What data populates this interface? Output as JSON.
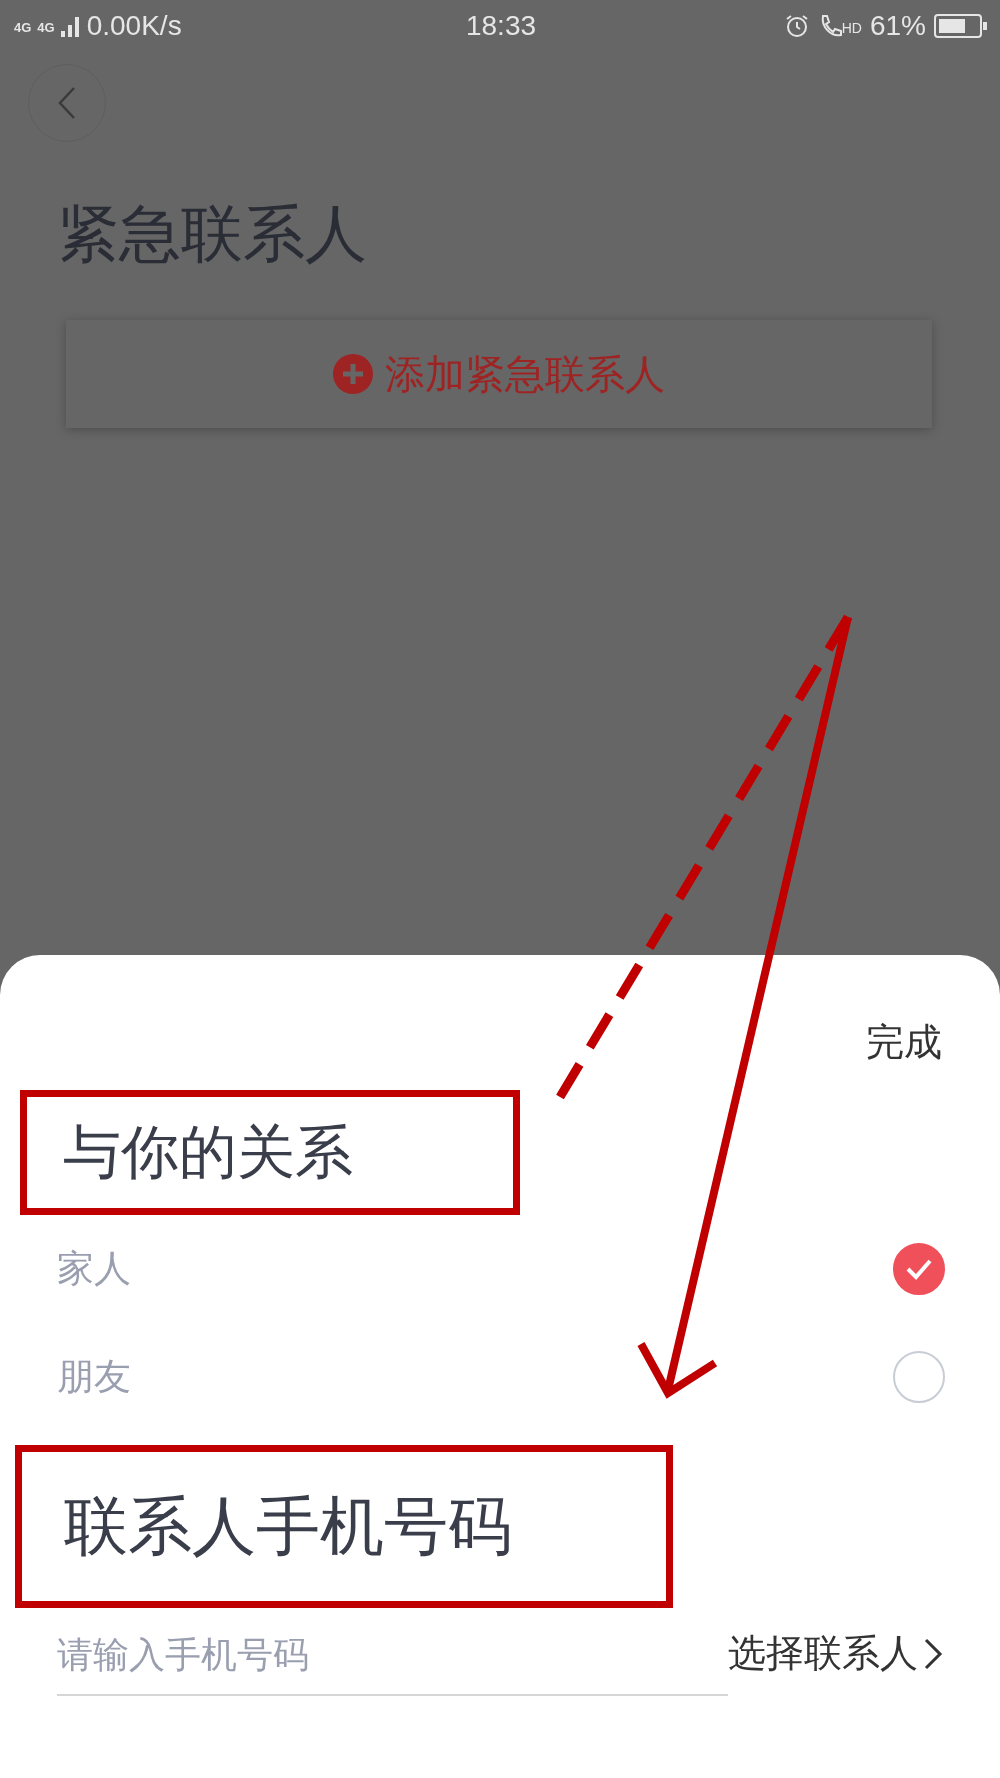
{
  "status_bar": {
    "network": [
      "4G",
      "4G"
    ],
    "speed": "0.00K/s",
    "time": "18:33",
    "hd": "HD",
    "battery": "61%"
  },
  "page": {
    "title": "紧急联系人",
    "add_button": "添加紧急联系人"
  },
  "sheet": {
    "done": "完成",
    "relation_heading": "与你的关系",
    "options": [
      {
        "label": "家人",
        "selected": true
      },
      {
        "label": "朋友",
        "selected": false
      }
    ],
    "phone_heading": "联系人手机号码",
    "phone_field": {
      "placeholder": "请输入手机号码"
    },
    "pick_contact": "选择联系人"
  }
}
